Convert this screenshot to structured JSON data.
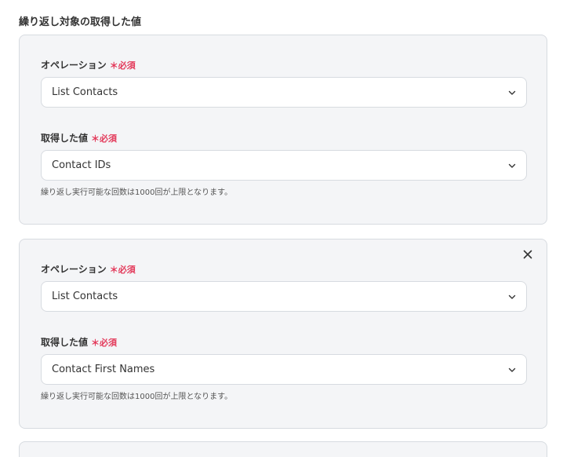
{
  "section_title": "繰り返し対象の取得した値",
  "required_mark": "＊必須",
  "cards": [
    {
      "operation_label": "オペレーション",
      "operation_value": "List Contacts",
      "value_label": "取得した値",
      "value_value": "Contact IDs",
      "hint": "繰り返し実行可能な回数は1000回が上限となります。"
    },
    {
      "operation_label": "オペレーション",
      "operation_value": "List Contacts",
      "value_label": "取得した値",
      "value_value": "Contact First Names",
      "hint": "繰り返し実行可能な回数は1000回が上限となります。"
    }
  ],
  "icons": {
    "dropdown": "chevron-down-icon",
    "remove": "close-icon"
  },
  "colors": {
    "required": "#e3395a",
    "card_bg": "#f4f5f7",
    "border": "#d7dbe0"
  }
}
